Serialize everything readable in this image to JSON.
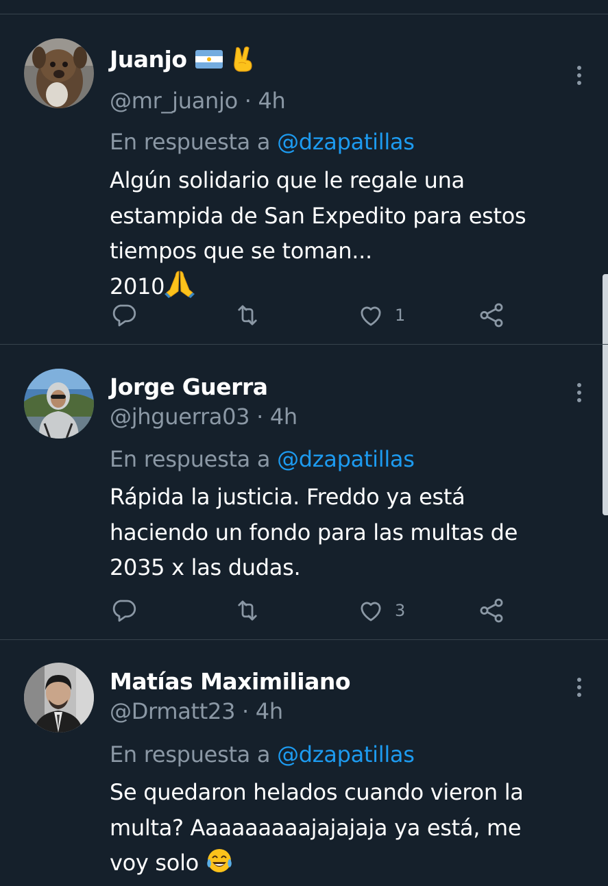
{
  "reply_prefix": "En respuesta a",
  "tweets": [
    {
      "name": "Juanjo",
      "handle": "@mr_juanjo",
      "time": "4h",
      "reply_to": "@dzapatillas",
      "lines": [
        "Algún solidario que le regale una",
        "estampida de San Expedito para estos",
        "tiempos que se toman...",
        "2010"
      ],
      "emoji_after_last_line": "folded-hands-emoji",
      "name_emojis": [
        "argentina-flag-icon",
        "victory-hand-emoji"
      ],
      "reply_count": "",
      "retweet_count": "",
      "like_count": "1"
    },
    {
      "name": "Jorge Guerra",
      "handle": "@jhguerra03",
      "time": "4h",
      "reply_to": "@dzapatillas",
      "lines": [
        "Rápida la justicia. Freddo ya está",
        "haciendo un fondo para las multas de",
        "2035 x las dudas."
      ],
      "reply_count": "",
      "retweet_count": "",
      "like_count": "3"
    },
    {
      "name": "Matías Maximiliano",
      "handle": "@Drmatt23",
      "time": "4h",
      "reply_to": "@dzapatillas",
      "lines": [
        "Se quedaron helados cuando vieron la",
        "multa? Aaaaaaaaajajajaja ya está, me",
        "voy solo"
      ],
      "emoji_after_last_line": "tears-of-joy-emoji"
    }
  ],
  "colors": {
    "background": "#15202b",
    "divider": "#38444d",
    "secondary_text": "#8b98a5",
    "link": "#1d9bf0"
  }
}
